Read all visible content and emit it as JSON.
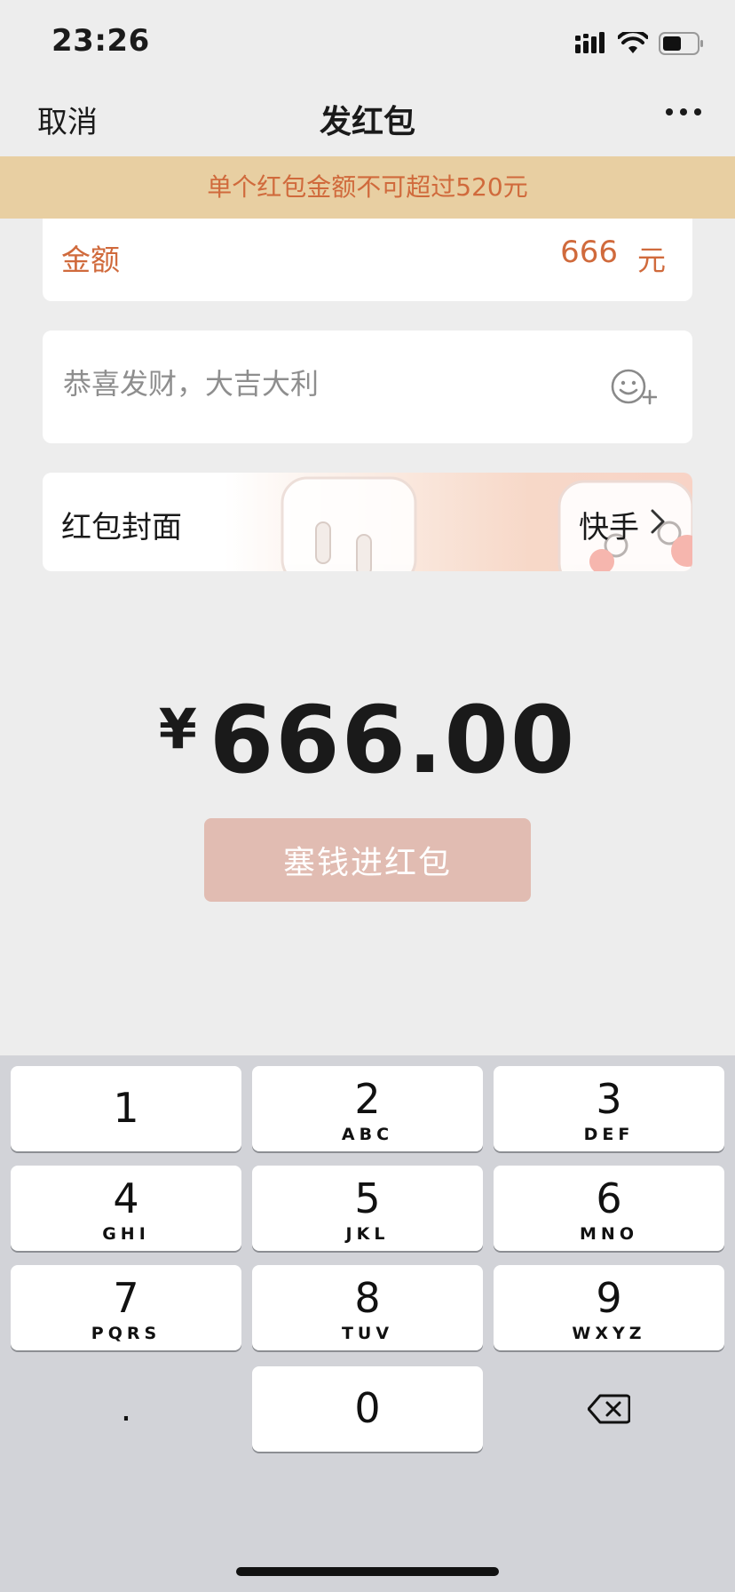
{
  "status": {
    "time": "23:26"
  },
  "nav": {
    "cancel": "取消",
    "title": "发红包"
  },
  "warning": "单个红包金额不可超过520元",
  "amount": {
    "label": "金额",
    "value": "666",
    "unit": "元"
  },
  "greeting": {
    "placeholder": "恭喜发财，大吉大利"
  },
  "cover": {
    "label": "红包封面",
    "value": "快手"
  },
  "total": {
    "symbol": "¥",
    "value": "666.00"
  },
  "submit_label": "塞钱进红包",
  "keypad": {
    "keys": [
      {
        "digit": "1",
        "letters": ""
      },
      {
        "digit": "2",
        "letters": "ABC"
      },
      {
        "digit": "3",
        "letters": "DEF"
      },
      {
        "digit": "4",
        "letters": "GHI"
      },
      {
        "digit": "5",
        "letters": "JKL"
      },
      {
        "digit": "6",
        "letters": "MNO"
      },
      {
        "digit": "7",
        "letters": "PQRS"
      },
      {
        "digit": "8",
        "letters": "TUV"
      },
      {
        "digit": "9",
        "letters": "WXYZ"
      }
    ],
    "zero": "0",
    "dot": "."
  },
  "colors": {
    "accent": "#d06a3c",
    "warning_bg": "#e8cfa2",
    "button_disabled": "#e1bcb2"
  }
}
